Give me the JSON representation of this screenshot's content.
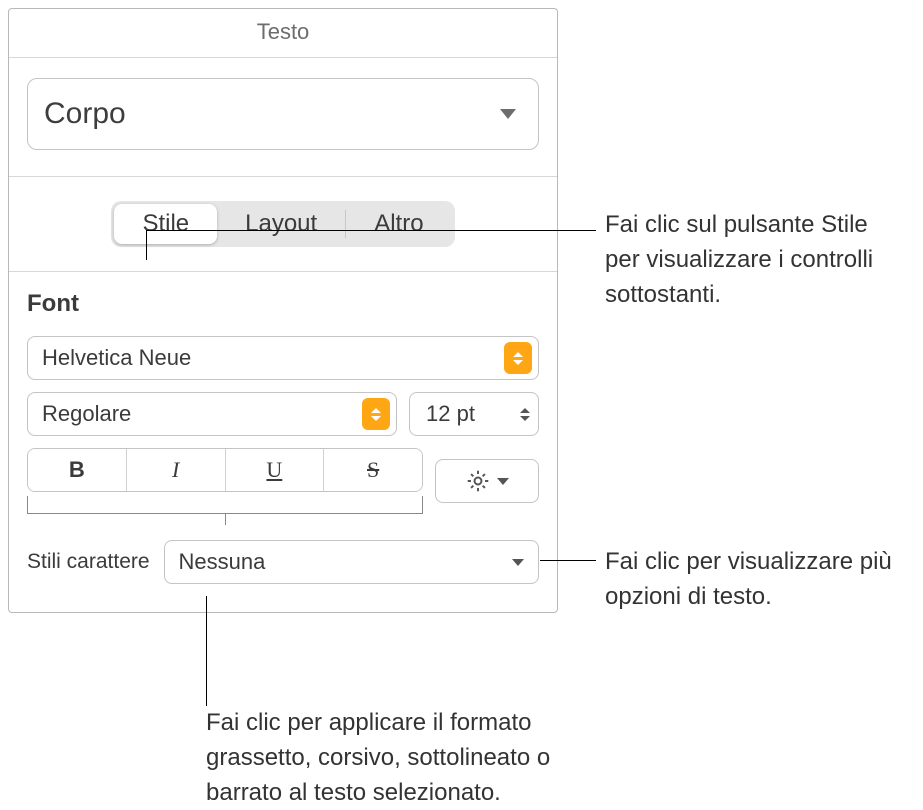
{
  "header": {
    "title": "Testo"
  },
  "paragraph_style": {
    "value": "Corpo"
  },
  "tabs": {
    "items": [
      {
        "label": "Stile",
        "active": true
      },
      {
        "label": "Layout",
        "active": false
      },
      {
        "label": "Altro",
        "active": false
      }
    ]
  },
  "font": {
    "section_label": "Font",
    "family": "Helvetica Neue",
    "typeface": "Regolare",
    "size": "12 pt",
    "buttons": {
      "bold": "B",
      "italic": "I",
      "underline": "U",
      "strike": "S"
    },
    "char_styles_label": "Stili carattere",
    "char_styles_value": "Nessuna"
  },
  "callouts": {
    "stile": "Fai clic sul pulsante Stile per visualizzare i controlli sottostanti.",
    "gear": "Fai clic per visualizzare più opzioni di testo.",
    "bius": "Fai clic per applicare il formato grassetto, corsivo, sottolineato o barrato al testo selezionato."
  }
}
